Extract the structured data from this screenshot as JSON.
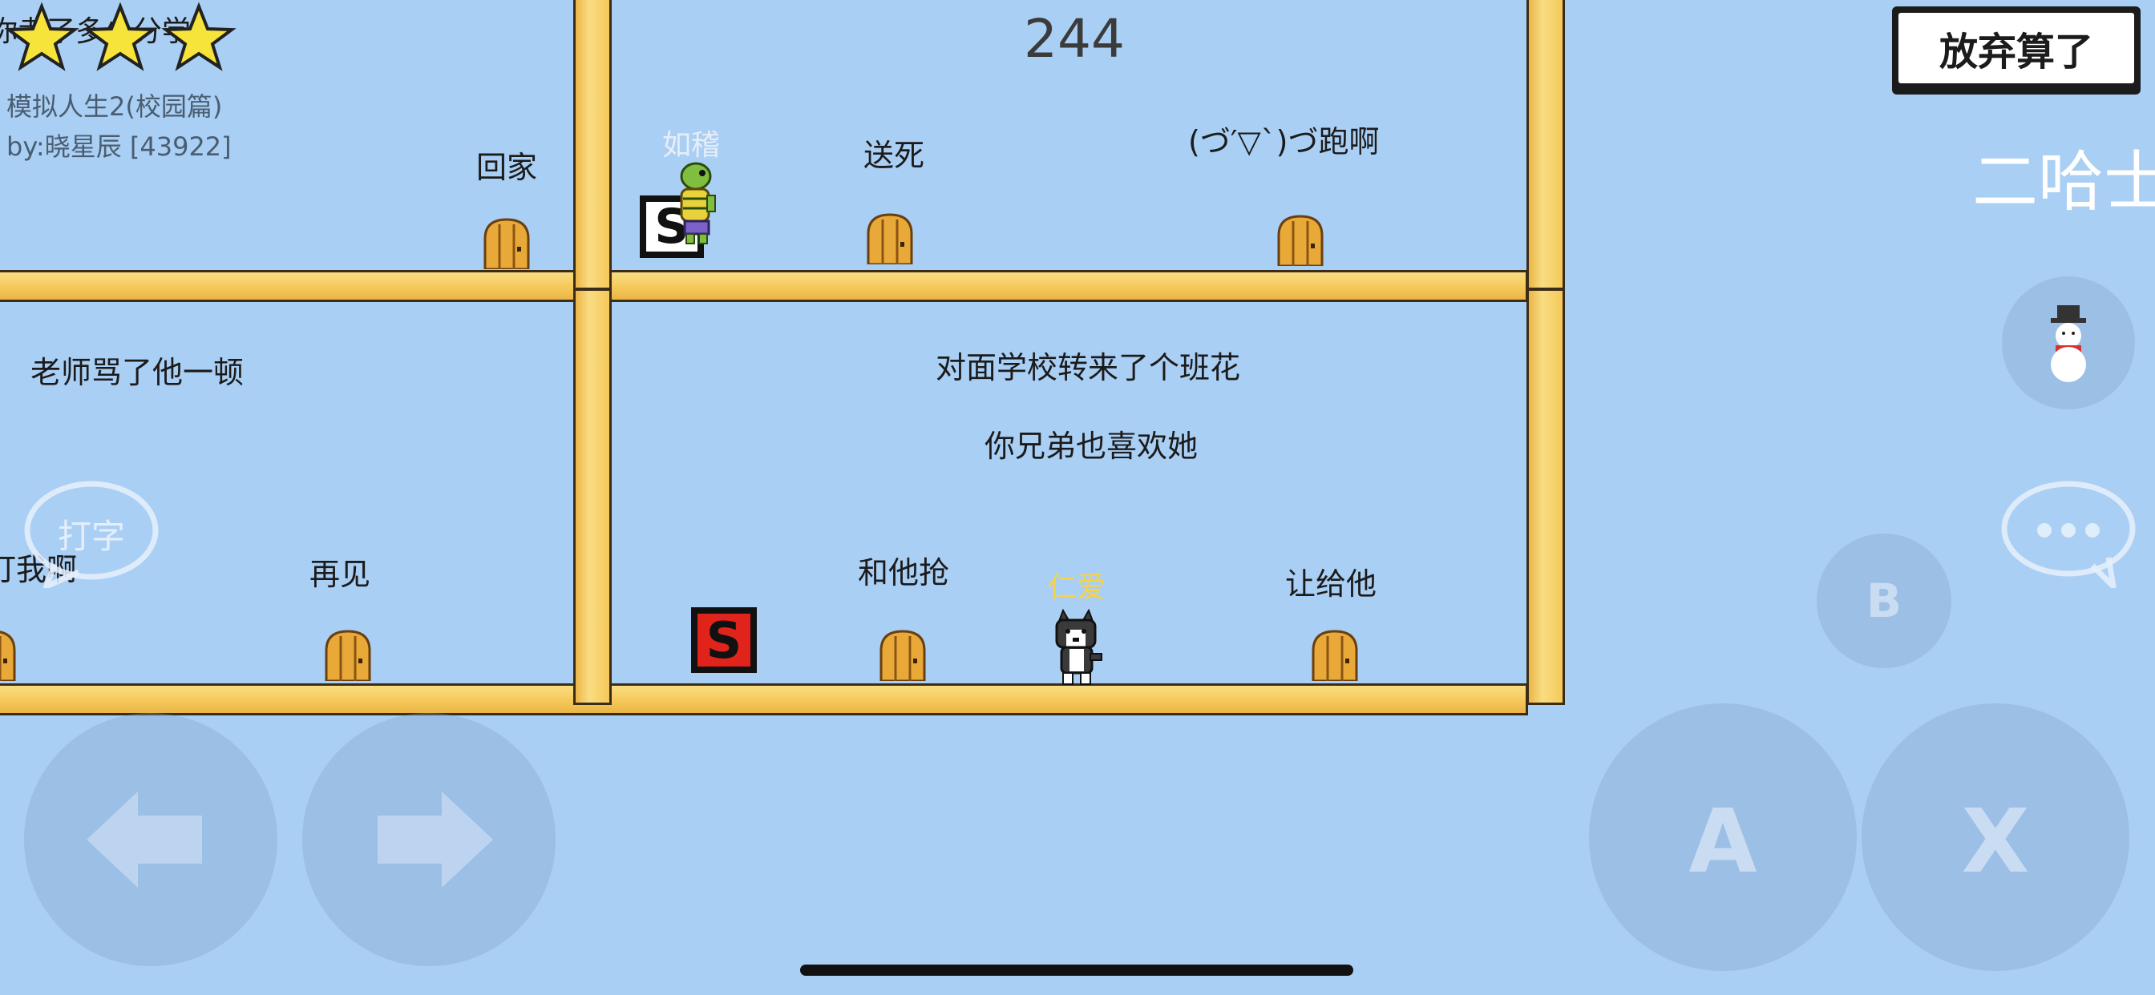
{
  "hud": {
    "timer": "244",
    "give_up_button": "放弃算了",
    "player_name_right": "二哈士",
    "level_title": "模拟人生2(校园篇)",
    "author": "by:晓星辰 [43922]",
    "stars": 3,
    "partial_text_behind_stars": "你考了多少分学"
  },
  "room_top": {
    "left_choice": "回家",
    "mid_choice": "送死",
    "right_choice": "(づ′▽`)づ跑啊"
  },
  "room_bottom_left": {
    "event_text": "老师骂了他一顿",
    "left_choice_partial": "打我啊",
    "right_choice": "再见"
  },
  "room_bottom_main": {
    "event_line1": "对面学校转来了个班花",
    "event_line2": "你兄弟也喜欢她",
    "left_choice": "和他抢",
    "right_choice": "让给他"
  },
  "characters": {
    "turtle_name": "如稽",
    "dog_name": "仁爱"
  },
  "controls": {
    "chat_typing_label": "打字",
    "b_label": "B",
    "a_label": "A",
    "x_label": "X",
    "snowman_icon": "snowman-icon",
    "left_arrow_icon": "arrow-left-icon",
    "right_arrow_icon": "arrow-right-icon",
    "chat_icon": "chat-bubble-icon"
  },
  "colors": {
    "background": "#aacff4",
    "beam": "#f5c95a",
    "save_red": "#e0241b",
    "dog_name_color": "#f5d24a"
  }
}
